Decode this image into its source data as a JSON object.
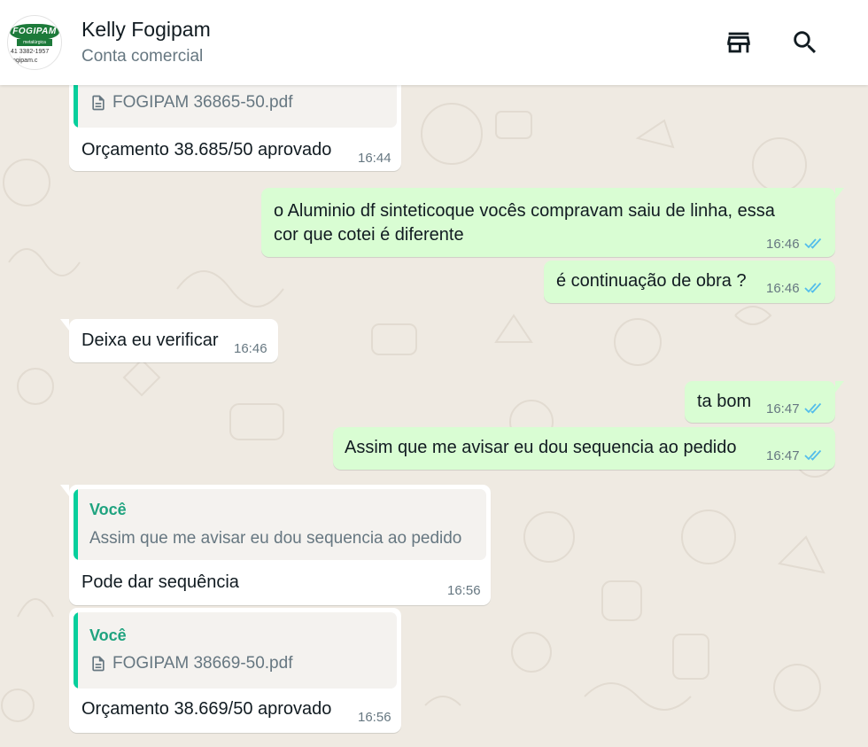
{
  "header": {
    "contact_name": "Kelly Fogipam",
    "contact_subtitle": "Conta comercial",
    "avatar": {
      "logo": "FOGIPAM",
      "sub": "metalúrgica",
      "phone": "41 3382-1957",
      "site": "fogipam.c"
    },
    "icons": [
      "store-icon",
      "search-icon"
    ]
  },
  "colors": {
    "incoming": "#ffffff",
    "outgoing": "#d9fdd3",
    "read_tick": "#53bdeb",
    "quote_bar": "#06cf9c"
  },
  "messages": [
    {
      "direction": "in",
      "quote_file": "FOGIPAM 36865-50.pdf",
      "text": "Orçamento 38.685/50 aprovado",
      "time": "16:44"
    },
    {
      "direction": "out",
      "text_line1": "o Aluminio df sinteticoque vocês compravam saiu de linha, essa",
      "text_line2": "cor que cotei é diferente",
      "time": "16:46",
      "status": "read"
    },
    {
      "direction": "out",
      "text": "é continuação de obra ?",
      "time": "16:46",
      "status": "read"
    },
    {
      "direction": "in",
      "text": "Deixa eu verificar",
      "time": "16:46"
    },
    {
      "direction": "out",
      "text": "ta bom",
      "time": "16:47",
      "status": "read"
    },
    {
      "direction": "out",
      "text": "Assim que me avisar eu dou sequencia ao pedido",
      "time": "16:47",
      "status": "read"
    },
    {
      "direction": "in",
      "quote_author": "Você",
      "quote_text": "Assim que me avisar eu dou sequencia ao pedido",
      "text": "Pode dar sequência",
      "time": "16:56"
    },
    {
      "direction": "in",
      "quote_author": "Você",
      "quote_file": "FOGIPAM 38669-50.pdf",
      "text": "Orçamento 38.669/50 aprovado",
      "time": "16:56"
    }
  ]
}
